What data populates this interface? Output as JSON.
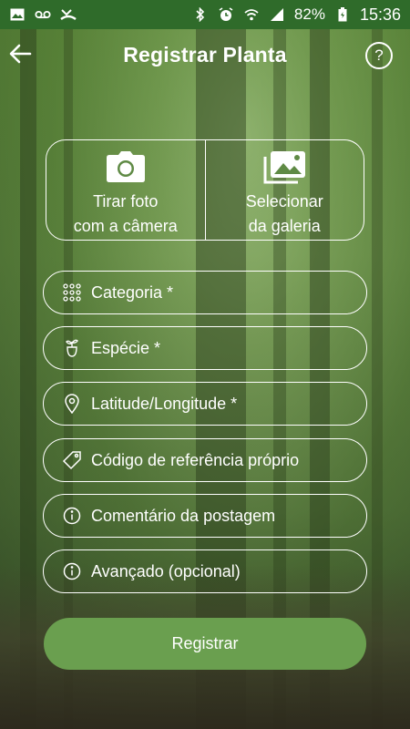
{
  "status_bar": {
    "battery": "82%",
    "time": "15:36",
    "icons_left": [
      "image-icon",
      "voicemail-icon",
      "missed-call-icon"
    ],
    "icons_right": [
      "bluetooth-icon",
      "alarm-icon",
      "wifi-icon",
      "signal-icon",
      "battery-icon"
    ]
  },
  "header": {
    "title": "Registrar Planta",
    "help_glyph": "?"
  },
  "photo": {
    "camera_label": "Tirar foto\ncom a câmera",
    "gallery_label": "Selecionar\nda galeria"
  },
  "fields": {
    "category": "Categoria *",
    "species": "Espécie *",
    "latlng": "Latitude/Longitude *",
    "ref_code": "Código de referência próprio",
    "comment": "Comentário da postagem",
    "advanced": "Avançado (opcional)"
  },
  "submit_label": "Registrar",
  "colors": {
    "status_bar": "#2f6b2a",
    "button": "#6a9f4f",
    "text": "#ffffff"
  }
}
